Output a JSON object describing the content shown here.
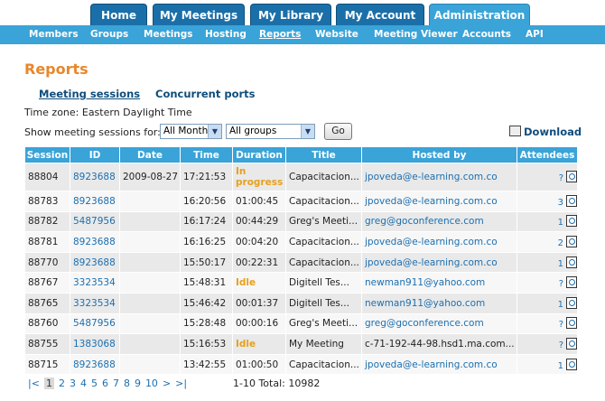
{
  "top_nav": [
    "Home",
    "My Meetings",
    "My Library",
    "My Account",
    "Administration"
  ],
  "sub_nav": [
    "Members",
    "Groups",
    "Meetings",
    "Hosting",
    "Reports",
    "Website",
    "Meeting Viewer",
    "Accounts",
    "API"
  ],
  "page": {
    "title": "Reports",
    "tabs": [
      "Meeting sessions",
      "Concurrent ports"
    ],
    "timezone": "Time zone: Eastern Daylight Time",
    "filter_label": "Show meeting sessions for:",
    "months_select": "All Months",
    "groups_select": "All groups",
    "go": "Go",
    "download": "Download"
  },
  "table": {
    "headers": [
      "Session",
      "ID",
      "Date",
      "Time",
      "Duration",
      "Title",
      "Hosted by",
      "Attendees"
    ],
    "rows": [
      {
        "session": "88804",
        "id": "8923688",
        "date": "2009-08-27",
        "time": "17:21:53",
        "duration": "In progress",
        "title": "Capacitacion...",
        "host": "jpoveda@e-learning.com.co",
        "attendees": "?"
      },
      {
        "session": "88783",
        "id": "8923688",
        "date": "",
        "time": "16:20:56",
        "duration": "01:00:45",
        "title": "Capacitacion...",
        "host": "jpoveda@e-learning.com.co",
        "attendees": "3"
      },
      {
        "session": "88782",
        "id": "5487956",
        "date": "",
        "time": "16:17:24",
        "duration": "00:44:29",
        "title": "Greg's Meeti...",
        "host": "greg@goconference.com",
        "attendees": "1"
      },
      {
        "session": "88781",
        "id": "8923688",
        "date": "",
        "time": "16:16:25",
        "duration": "00:04:20",
        "title": "Capacitacion...",
        "host": "jpoveda@e-learning.com.co",
        "attendees": "2"
      },
      {
        "session": "88770",
        "id": "8923688",
        "date": "",
        "time": "15:50:17",
        "duration": "00:22:31",
        "title": "Capacitacion...",
        "host": "jpoveda@e-learning.com.co",
        "attendees": "1"
      },
      {
        "session": "88767",
        "id": "3323534",
        "date": "",
        "time": "15:48:31",
        "duration": "Idle",
        "title": "Digitell Tes...",
        "host": "newman911@yahoo.com",
        "attendees": "?"
      },
      {
        "session": "88765",
        "id": "3323534",
        "date": "",
        "time": "15:46:42",
        "duration": "00:01:37",
        "title": "Digitell Tes...",
        "host": "newman911@yahoo.com",
        "attendees": "1"
      },
      {
        "session": "88760",
        "id": "5487956",
        "date": "",
        "time": "15:28:48",
        "duration": "00:00:16",
        "title": "Greg's Meeti...",
        "host": "greg@goconference.com",
        "attendees": "?"
      },
      {
        "session": "88755",
        "id": "1383068",
        "date": "",
        "time": "15:16:53",
        "duration": "Idle",
        "title": "My Meeting",
        "host": "c-71-192-44-98.hsd1.ma.com...",
        "attendees": "?"
      },
      {
        "session": "88715",
        "id": "8923688",
        "date": "",
        "time": "13:42:55",
        "duration": "01:00:50",
        "title": "Capacitacion...",
        "host": "jpoveda@e-learning.com.co",
        "attendees": "1"
      }
    ]
  },
  "pager": {
    "first": "|<",
    "pages": [
      "1",
      "2",
      "3",
      "4",
      "5",
      "6",
      "7",
      "8",
      "9",
      "10"
    ],
    "next": ">",
    "last": ">|",
    "info": "1-10 Total: 10982"
  }
}
